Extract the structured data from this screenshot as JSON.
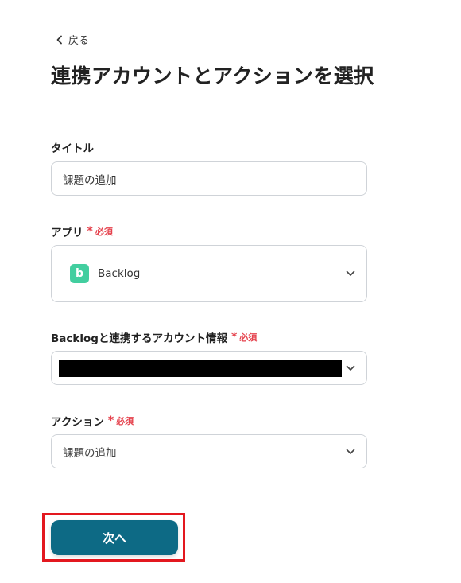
{
  "back": {
    "label": "戻る"
  },
  "page_title": "連携アカウントとアクションを選択",
  "required_label": "必須",
  "fields": {
    "title": {
      "label": "タイトル",
      "value": "課題の追加"
    },
    "app": {
      "label": "アプリ",
      "value": "Backlog",
      "icon_letter": "b",
      "icon_color": "#42ce9f"
    },
    "account": {
      "label": "Backlogと連携するアカウント情報",
      "value": ""
    },
    "action": {
      "label": "アクション",
      "value": "課題の追加"
    }
  },
  "next_button": {
    "label": "次へ",
    "color": "#0d6a85",
    "highlight_color": "#e3181f"
  }
}
